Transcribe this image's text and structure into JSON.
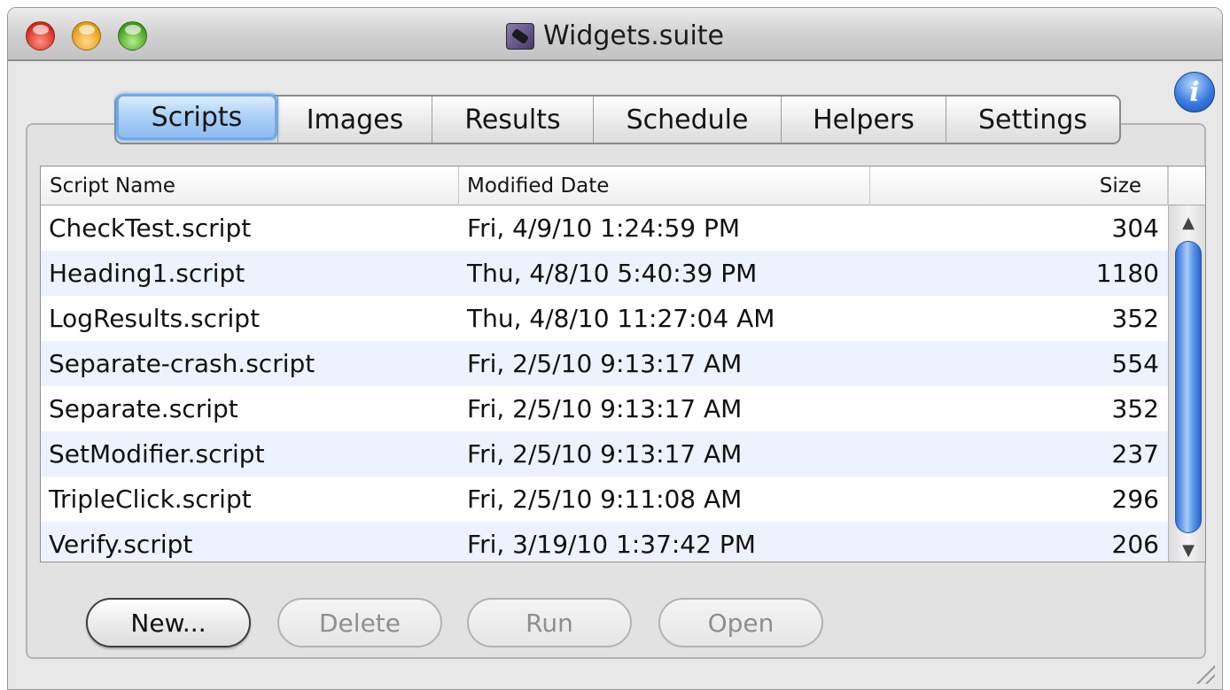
{
  "window": {
    "title": "Widgets.suite"
  },
  "tabs": [
    {
      "label": "Scripts",
      "active": true
    },
    {
      "label": "Images",
      "active": false
    },
    {
      "label": "Results",
      "active": false
    },
    {
      "label": "Schedule",
      "active": false
    },
    {
      "label": "Helpers",
      "active": false
    },
    {
      "label": "Settings",
      "active": false
    }
  ],
  "info_button": {
    "label": "i"
  },
  "table": {
    "columns": [
      "Script Name",
      "Modified Date",
      "Size"
    ],
    "rows": [
      {
        "name": "CheckTest.script",
        "date": "Fri, 4/9/10 1:24:59 PM",
        "size": "304"
      },
      {
        "name": "Heading1.script",
        "date": "Thu, 4/8/10 5:40:39 PM",
        "size": "1180"
      },
      {
        "name": "LogResults.script",
        "date": "Thu, 4/8/10 11:27:04 AM",
        "size": "352"
      },
      {
        "name": "Separate-crash.script",
        "date": "Fri, 2/5/10 9:13:17 AM",
        "size": "554"
      },
      {
        "name": "Separate.script",
        "date": "Fri, 2/5/10 9:13:17 AM",
        "size": "352"
      },
      {
        "name": "SetModifier.script",
        "date": "Fri, 2/5/10 9:13:17 AM",
        "size": "237"
      },
      {
        "name": "TripleClick.script",
        "date": "Fri, 2/5/10 9:11:08 AM",
        "size": "296"
      },
      {
        "name": "Verify.script",
        "date": "Fri, 3/19/10 1:37:42 PM",
        "size": "206"
      }
    ]
  },
  "buttons": {
    "new": {
      "label": "New...",
      "enabled": true
    },
    "delete": {
      "label": "Delete",
      "enabled": false
    },
    "run": {
      "label": "Run",
      "enabled": false
    },
    "open": {
      "label": "Open",
      "enabled": false
    }
  },
  "colors": {
    "tab_active": "#a9cff6",
    "row_stripe": "#edf3fe",
    "scroll_thumb": "#5a95ea"
  }
}
